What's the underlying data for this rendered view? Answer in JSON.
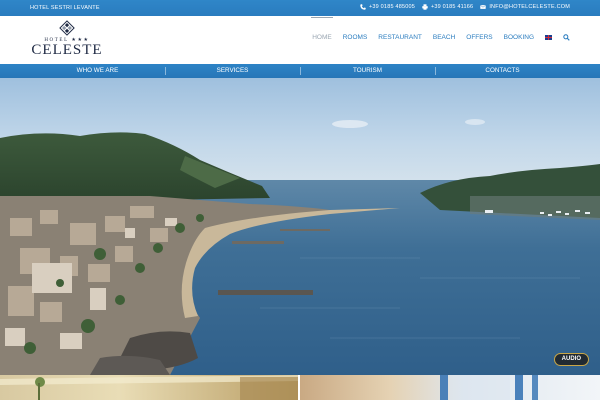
{
  "topbar": {
    "hotel_name": "HOTEL SESTRI LEVANTE",
    "contacts": [
      {
        "icon": "phone-icon",
        "text": "+39 0185 485005"
      },
      {
        "icon": "fax-icon",
        "text": "+39 0185 41166"
      },
      {
        "icon": "envelope-icon",
        "text": "INFO@HOTELCELESTE.COM"
      }
    ]
  },
  "logo": {
    "hotel_word": "HOTEL ★★★",
    "brand": "CELESTE"
  },
  "nav": {
    "items": [
      "HOME",
      "ROOMS",
      "RESTAURANT",
      "BEACH",
      "OFFERS",
      "BOOKING"
    ],
    "active": "HOME"
  },
  "subnav": {
    "items": [
      "WHO WE ARE",
      "SERVICES",
      "TOURISM",
      "CONTACTS"
    ]
  },
  "hero": {
    "audio_label": "AUDIO"
  },
  "colors": {
    "brand_blue": "#2a7cbf",
    "audio_border": "#c9a646",
    "logo_navy": "#1f2a44"
  }
}
